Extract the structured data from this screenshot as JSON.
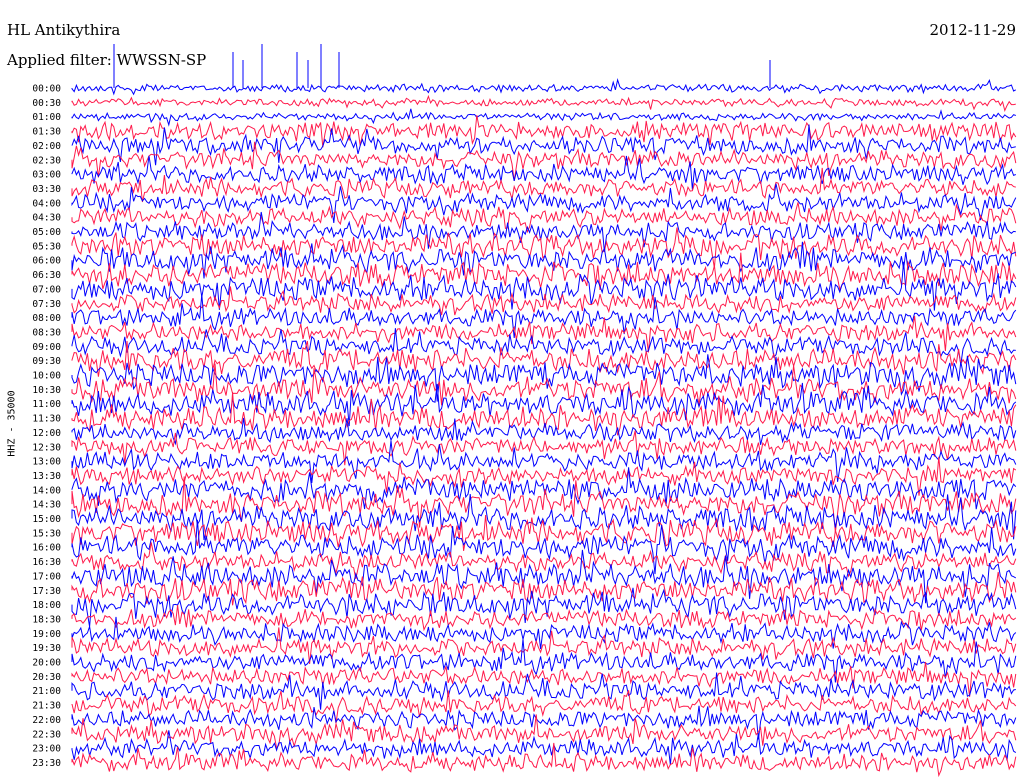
{
  "header": {
    "station": "HL Antikythira",
    "filter": "Applied filter: WWSSN-SP",
    "date": "2012-11-29"
  },
  "chart_data": {
    "type": "line",
    "title": "HL Antikythira",
    "subtitle": "Applied filter: WWSSN-SP",
    "ylabel": "HHZ - 35000",
    "xlabel": "",
    "y_tick_labels": [
      "00:00",
      "00:30",
      "01:00",
      "01:30",
      "02:00",
      "02:30",
      "03:00",
      "03:30",
      "04:00",
      "04:30",
      "05:00",
      "05:30",
      "06:00",
      "06:30",
      "07:00",
      "07:30",
      "08:00",
      "08:30",
      "09:00",
      "09:30",
      "10:00",
      "10:30",
      "11:00",
      "11:30",
      "12:00",
      "12:30",
      "13:00",
      "13:30",
      "14:00",
      "14:30",
      "15:00",
      "15:30",
      "16:00",
      "16:30",
      "17:00",
      "17:30",
      "18:00",
      "18:30",
      "19:00",
      "19:30",
      "20:00",
      "20:30",
      "21:00",
      "21:30",
      "22:00",
      "22:30",
      "23:00",
      "23:30"
    ],
    "trace_colors": [
      "#0000ff",
      "#ff1a4b"
    ],
    "background": "#ffffff",
    "grid": false,
    "noisy_intervals": [
      "05:30",
      "06:00",
      "06:30",
      "07:00",
      "09:30",
      "10:00",
      "10:30",
      "11:00",
      "11:30",
      "14:00",
      "14:30",
      "15:00",
      "15:30",
      "16:00",
      "17:00",
      "17:30",
      "18:00"
    ]
  }
}
